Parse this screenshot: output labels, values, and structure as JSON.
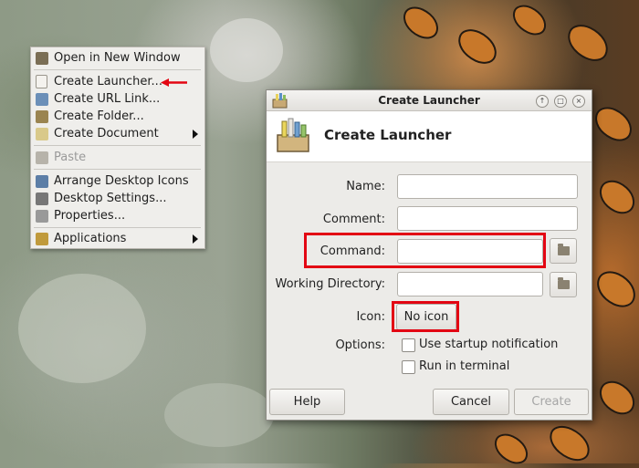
{
  "menu": {
    "items": [
      {
        "label": "Open in New Window",
        "icon": "open-window-icon",
        "color": "#7a6e55"
      },
      {
        "label": "Create Launcher...",
        "icon": "launcher-icon",
        "color": "#d7d3ca"
      },
      {
        "label": "Create URL Link...",
        "icon": "url-link-icon",
        "color": "#6b8fb8"
      },
      {
        "label": "Create Folder...",
        "icon": "folder-icon",
        "color": "#9a8450"
      },
      {
        "label": "Create Document",
        "icon": "document-icon",
        "color": "#d9c98a"
      },
      {
        "label": "Paste",
        "icon": "paste-icon",
        "color": "#b7b3aa"
      },
      {
        "label": "Arrange Desktop Icons",
        "icon": "arrange-icon",
        "color": "#5c7ea6"
      },
      {
        "label": "Desktop Settings...",
        "icon": "desktop-settings-icon",
        "color": "#777"
      },
      {
        "label": "Properties...",
        "icon": "properties-icon",
        "color": "#888"
      },
      {
        "label": "Applications",
        "icon": "applications-icon",
        "color": "#c09a3c"
      }
    ]
  },
  "dialog": {
    "title": "Create Launcher",
    "header": "Create Launcher",
    "labels": {
      "name": "Name:",
      "comment": "Comment:",
      "command": "Command:",
      "working_directory": "Working Directory:",
      "icon": "Icon:",
      "options": "Options:"
    },
    "values": {
      "name": "",
      "comment": "",
      "command": "",
      "working_directory": ""
    },
    "icon_button": "No icon",
    "options": {
      "startup_notification": "Use startup notification",
      "run_in_terminal": "Run in terminal"
    },
    "buttons": {
      "help": "Help",
      "cancel": "Cancel",
      "create": "Create"
    }
  },
  "colors": {
    "highlight": "#e30613"
  }
}
